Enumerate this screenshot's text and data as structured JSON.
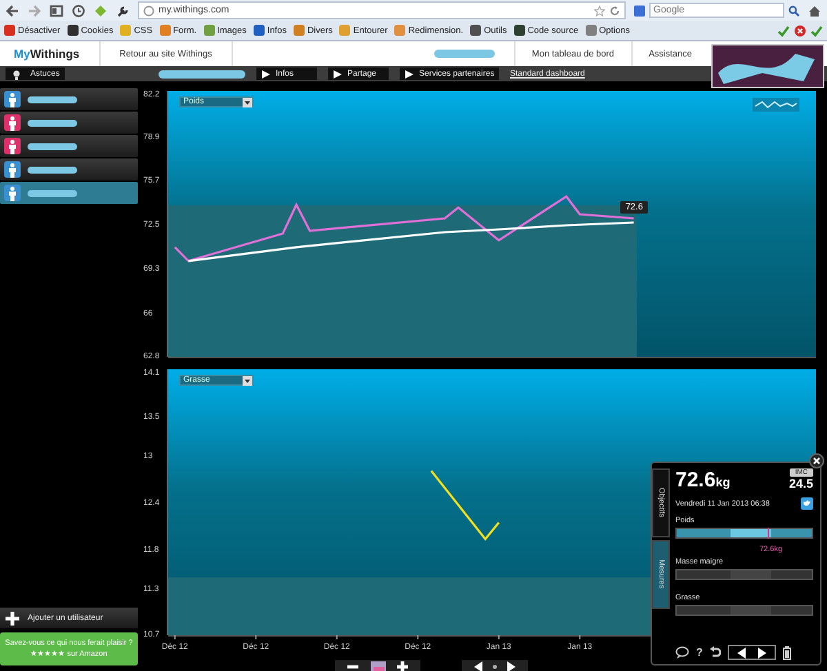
{
  "browser": {
    "url": "my.withings.com",
    "search": {
      "placeholder": "Google"
    },
    "toolbar": [
      {
        "label": "Désactiver",
        "color": "#d8301e"
      },
      {
        "label": "Cookies",
        "color": "#303030"
      },
      {
        "label": "CSS",
        "color": "#e0b020"
      },
      {
        "label": "Form.",
        "color": "#e08020"
      },
      {
        "label": "Images",
        "color": "#70a040"
      },
      {
        "label": "Infos",
        "color": "#2060c0"
      },
      {
        "label": "Divers",
        "color": "#d08020"
      },
      {
        "label": "Entourer",
        "color": "#e0a030"
      },
      {
        "label": "Redimension.",
        "color": "#e09040"
      },
      {
        "label": "Outils",
        "color": "#505050"
      },
      {
        "label": "Code source",
        "color": "#304030"
      },
      {
        "label": "Options",
        "color": "#808080"
      }
    ]
  },
  "site": {
    "logo_prefix": "My",
    "logo_name": "Withings",
    "back_link": "Retour au site Withings",
    "nav": [
      {
        "label": "Mon tableau de bord"
      },
      {
        "label": "Assistance"
      }
    ]
  },
  "subnav": {
    "tips": "Astuces",
    "buttons": [
      {
        "label": "Infos"
      },
      {
        "label": "Partage"
      },
      {
        "label": "Services partenaires"
      }
    ],
    "link": "Standard dashboard"
  },
  "sidebar": {
    "users": [
      {
        "color": "#3a8fd0",
        "selected": false
      },
      {
        "color": "#e0306a",
        "selected": false
      },
      {
        "color": "#e0306a",
        "selected": false
      },
      {
        "color": "#3a8fd0",
        "selected": false
      },
      {
        "color": "#3a8fd0",
        "selected": true
      }
    ],
    "add_user": "Ajouter un utilisateur",
    "promo": {
      "line1": "Savez-vous ce qui nous ferait plaisir ?",
      "line2": "★★★★★ sur Amazon"
    }
  },
  "charts": [
    {
      "tooltip": "72.6",
      "chart_data": {
        "type": "line",
        "ylim": [
          62.8,
          82.2
        ],
        "yticks": [
          62.8,
          66,
          69.3,
          72.5,
          75.7,
          78.9,
          82.2
        ],
        "categories": [
          null,
          null,
          null,
          null,
          null,
          null,
          null,
          null,
          null,
          null,
          null,
          null,
          null,
          null,
          null,
          null,
          null,
          null,
          null,
          null,
          null,
          null,
          null,
          null,
          null,
          null,
          null,
          null,
          null,
          null,
          null,
          null,
          null,
          null,
          null,
          null,
          null,
          null,
          null,
          null,
          null,
          null,
          null,
          null,
          null,
          null,
          null,
          null
        ],
        "series": [
          {
            "name": "Poids",
            "color": "#e070d8",
            "values": [
              70.8,
              69.8,
              null,
              null,
              null,
              null,
              null,
              null,
              71.8,
              73.9,
              72.0,
              null,
              null,
              null,
              null,
              null,
              null,
              null,
              null,
              null,
              72.9,
              73.7,
              null,
              null,
              71.3,
              null,
              null,
              null,
              null,
              74.5,
              73.2,
              null,
              null,
              null,
              72.9,
              null,
              null,
              null,
              null,
              null,
              null,
              null,
              null,
              null,
              null,
              null,
              null,
              null
            ]
          },
          {
            "color": "#ffffff",
            "values": [
              null,
              69.8,
              null,
              null,
              null,
              null,
              null,
              null,
              null,
              70.8,
              null,
              null,
              null,
              null,
              null,
              null,
              null,
              null,
              null,
              null,
              71.9,
              null,
              null,
              null,
              72.1,
              null,
              null,
              null,
              null,
              72.4,
              null,
              null,
              null,
              null,
              72.6,
              null,
              null,
              null,
              null,
              null,
              null,
              null,
              null,
              null,
              null,
              null,
              null,
              null
            ]
          }
        ]
      }
    },
    {
      "chart_data": {
        "type": "line",
        "ylim": [
          10.7,
          14.1
        ],
        "yticks": [
          10.7,
          11.3,
          11.8,
          12.4,
          13,
          13.5,
          14.1
        ],
        "categories": [
          "Déc 12",
          null,
          null,
          null,
          null,
          null,
          "Déc 12",
          null,
          null,
          null,
          null,
          null,
          "Déc 12",
          null,
          null,
          null,
          null,
          null,
          "Déc 12",
          null,
          null,
          null,
          null,
          null,
          "Jan 13",
          null,
          null,
          null,
          null,
          null,
          "Jan 13",
          null,
          null,
          null,
          null,
          null,
          null,
          null,
          null,
          null,
          null,
          null,
          null,
          null,
          null,
          null,
          null,
          null
        ],
        "series": [
          {
            "name": "Grasse",
            "color": "#f0e020",
            "values": [
              null,
              null,
              null,
              null,
              null,
              null,
              null,
              null,
              null,
              null,
              null,
              null,
              null,
              null,
              null,
              null,
              null,
              null,
              null,
              12.8,
              null,
              null,
              null,
              11.93,
              12.14,
              null,
              null,
              null,
              null,
              null,
              null,
              null,
              null,
              null,
              null,
              null,
              null,
              null,
              null,
              null,
              null,
              null,
              null,
              null,
              null,
              null,
              null,
              null
            ]
          }
        ]
      }
    }
  ],
  "popup": {
    "weight": "72.6",
    "unit": "kg",
    "bmi_label": "IMC",
    "bmi": "24.5",
    "date": "Vendredi 11 Jan 2013 06:38",
    "tabs": [
      {
        "label": "Objectifs",
        "selected": false
      },
      {
        "label": "Mesures",
        "selected": true
      }
    ],
    "bars": [
      {
        "label": "Poids",
        "active": true,
        "level": 0.67,
        "reading": "72.6kg"
      },
      {
        "label": "Masse maigre",
        "active": false
      },
      {
        "label": "Grasse",
        "active": false
      }
    ],
    "help": "?"
  }
}
